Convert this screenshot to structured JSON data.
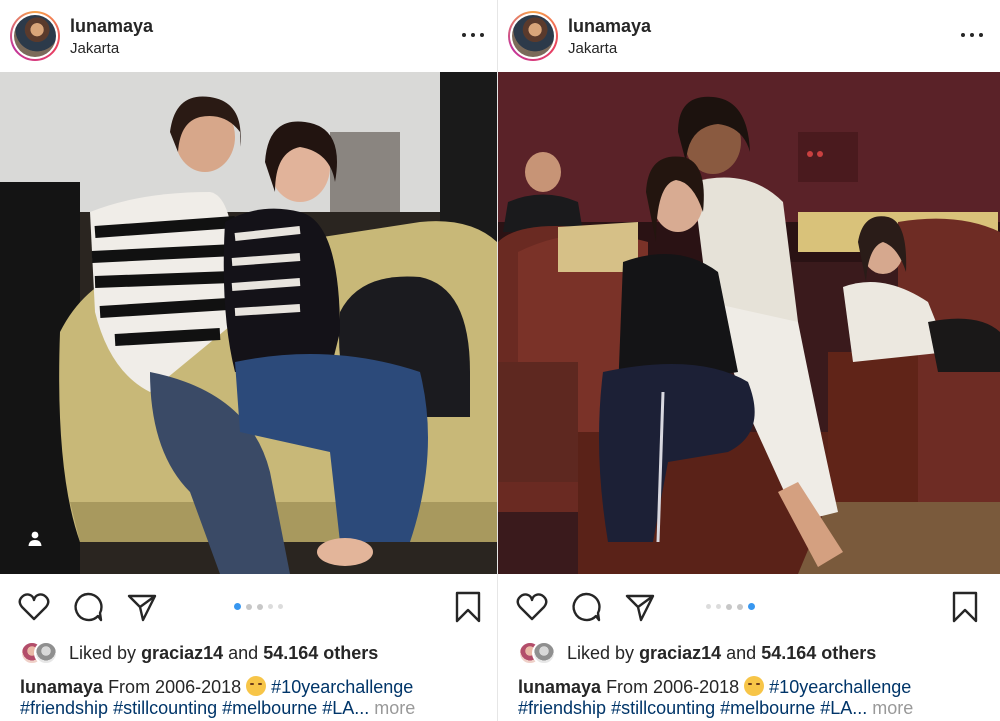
{
  "posts": [
    {
      "username": "lunamaya",
      "location": "Jakarta",
      "carousel": {
        "count": 5,
        "active_index": 0
      },
      "likes": {
        "prefix": "Liked by",
        "user": "graciaz14",
        "joiner": "and",
        "count": "54.164 others"
      },
      "caption": {
        "user": "lunamaya",
        "text": "From 2006-2018",
        "emoji": "smiling-face-with-hearts",
        "hashtags": [
          "#10yearchallenge",
          "#friendship",
          "#stillcounting",
          "#melbourne",
          "#LA..."
        ],
        "more": "more"
      }
    },
    {
      "username": "lunamaya",
      "location": "Jakarta",
      "carousel": {
        "count": 5,
        "active_index": 4
      },
      "likes": {
        "prefix": "Liked by",
        "user": "graciaz14",
        "joiner": "and",
        "count": "54.164 others"
      },
      "caption": {
        "user": "lunamaya",
        "text": "From 2006-2018",
        "emoji": "smiling-face-with-hearts",
        "hashtags": [
          "#10yearchallenge",
          "#friendship",
          "#stillcounting",
          "#melbourne",
          "#LA..."
        ],
        "more": "more"
      }
    }
  ],
  "icons": {
    "more": "more-horizontal-icon",
    "like": "heart-icon",
    "comment": "comment-icon",
    "share": "paper-plane-icon",
    "save": "bookmark-icon",
    "tagged": "user-tag-icon"
  },
  "colors": {
    "text": "#262626",
    "hashtag": "#003569",
    "secondary": "#999999",
    "carousel_active": "#3897f0"
  }
}
